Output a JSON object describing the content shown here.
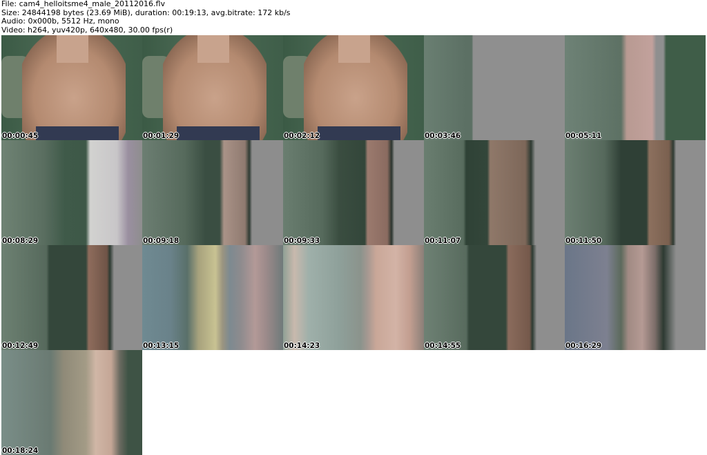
{
  "header": {
    "file": "File: cam4_helloitsme4_male_20112016.flv",
    "size": "Size: 24844198 bytes (23.69 MiB), duration: 00:19:13, avg.bitrate: 172 kb/s",
    "audio": "Audio: 0x000b, 5512 Hz, mono",
    "video": "Video: h264, yuv420p, 640x480, 30.00 fps(r)"
  },
  "thumbnails": [
    {
      "time": "00:00:45"
    },
    {
      "time": "00:01:29"
    },
    {
      "time": "00:02:12"
    },
    {
      "time": "00:03:46"
    },
    {
      "time": "00:05:11"
    },
    {
      "time": "00:08:29"
    },
    {
      "time": "00:09:18"
    },
    {
      "time": "00:09:33"
    },
    {
      "time": "00:11:07"
    },
    {
      "time": "00:11:50"
    },
    {
      "time": "00:12:49"
    },
    {
      "time": "00:13:15"
    },
    {
      "time": "00:14:23"
    },
    {
      "time": "00:14:55"
    },
    {
      "time": "00:16:29"
    },
    {
      "time": "00:18:24"
    }
  ]
}
